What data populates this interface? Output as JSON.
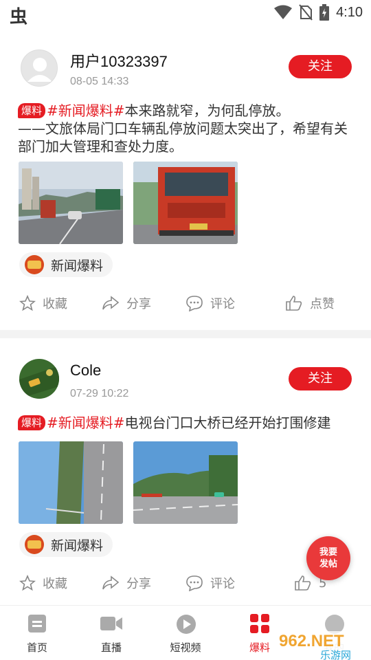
{
  "status_bar": {
    "app_icon_glyph": "虫",
    "time": "4:10",
    "icons": [
      "wifi-icon",
      "no-sim-icon",
      "battery-charging-icon"
    ]
  },
  "posts": [
    {
      "username": "用户10323397",
      "timestamp": "08-05 14:33",
      "follow_label": "关注",
      "badge": "爆料",
      "hashtag": "#新闻爆料#",
      "text": "本来路就窄，为何乱停放。\n——文旅体局门口车辆乱停放问题太突出了，希望有关部门加大管理和查处力度。",
      "topic_label": "新闻爆料",
      "actions": {
        "favorite": "收藏",
        "share": "分享",
        "comment": "评论",
        "like": "点赞"
      }
    },
    {
      "username": "Cole",
      "timestamp": "07-29 10:22",
      "follow_label": "关注",
      "badge": "爆料",
      "hashtag": "#新闻爆料#",
      "text": "电视台门口大桥已经开始打围修建",
      "topic_label": "新闻爆料",
      "actions": {
        "favorite": "收藏",
        "share": "分享",
        "comment": "评论",
        "like": "5"
      }
    }
  ],
  "fab": {
    "line1": "我要",
    "line2": "发帖"
  },
  "bottom_nav": [
    {
      "label": "首页",
      "icon": "home-icon"
    },
    {
      "label": "直播",
      "icon": "live-video-icon"
    },
    {
      "label": "短视频",
      "icon": "play-circle-icon"
    },
    {
      "label": "爆料",
      "icon": "grid-icon",
      "active": true
    },
    {
      "label": "我的",
      "icon": "profile-icon"
    }
  ],
  "watermark": {
    "line1": "962.NET",
    "line2": "乐游网"
  },
  "colors": {
    "accent": "#e51c23",
    "muted": "#888888",
    "divider": "#f3f3f3"
  }
}
